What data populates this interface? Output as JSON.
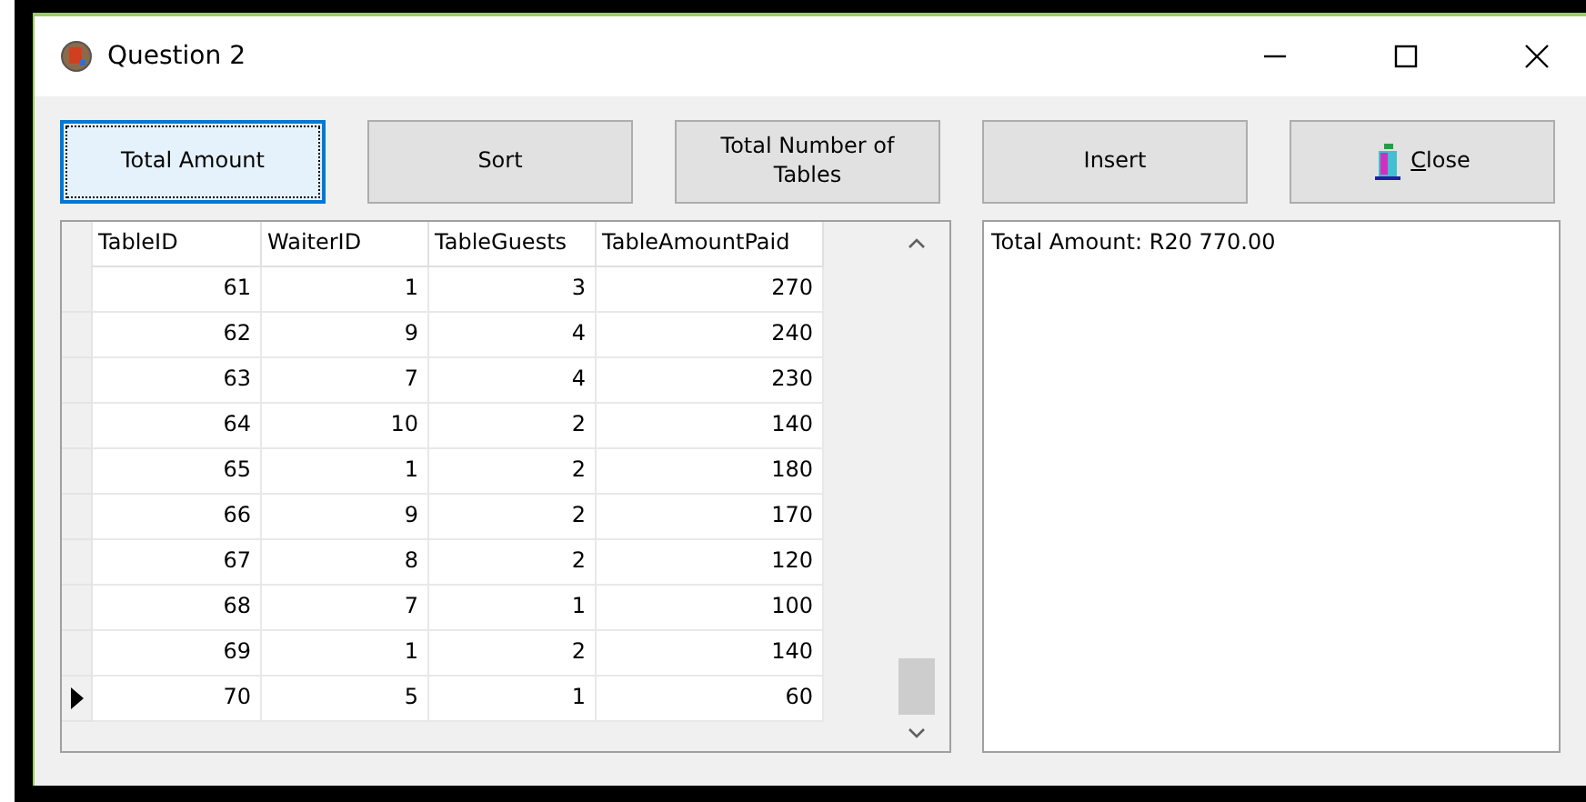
{
  "window": {
    "title": "Question 2"
  },
  "buttons": [
    {
      "label": "Total Amount",
      "focused": true,
      "kind": "text"
    },
    {
      "label": "Sort",
      "focused": false,
      "kind": "text"
    },
    {
      "label": "Total Number of Tables",
      "focused": false,
      "kind": "text"
    },
    {
      "label": "Insert",
      "focused": false,
      "kind": "text"
    },
    {
      "label": "Close",
      "focused": false,
      "kind": "icon"
    }
  ],
  "table": {
    "columns": [
      "TableID",
      "WaiterID",
      "TableGuests",
      "TableAmountPaid"
    ],
    "rows": [
      {
        "cells": [
          "61",
          "1",
          "3",
          "270"
        ],
        "selected": false
      },
      {
        "cells": [
          "62",
          "9",
          "4",
          "240"
        ],
        "selected": false
      },
      {
        "cells": [
          "63",
          "7",
          "4",
          "230"
        ],
        "selected": false
      },
      {
        "cells": [
          "64",
          "10",
          "2",
          "140"
        ],
        "selected": false
      },
      {
        "cells": [
          "65",
          "1",
          "2",
          "180"
        ],
        "selected": false
      },
      {
        "cells": [
          "66",
          "9",
          "2",
          "170"
        ],
        "selected": false
      },
      {
        "cells": [
          "67",
          "8",
          "2",
          "120"
        ],
        "selected": false
      },
      {
        "cells": [
          "68",
          "7",
          "1",
          "100"
        ],
        "selected": false
      },
      {
        "cells": [
          "69",
          "1",
          "2",
          "140"
        ],
        "selected": false
      },
      {
        "cells": [
          "70",
          "5",
          "1",
          "60"
        ],
        "selected": true
      }
    ]
  },
  "output": {
    "text": "Total Amount: R20 770.00"
  }
}
